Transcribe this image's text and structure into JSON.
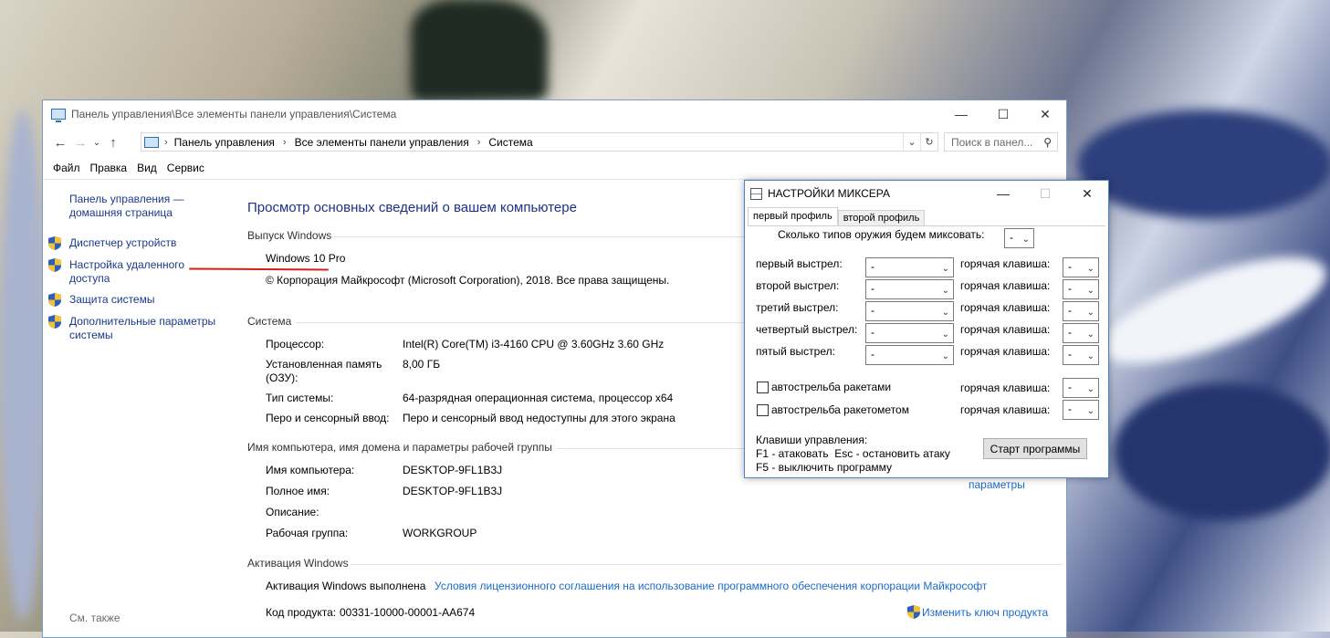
{
  "control_panel": {
    "title": "Панель управления\\Все элементы панели управления\\Система",
    "breadcrumb": [
      "Панель управления",
      "Все элементы панели управления",
      "Система"
    ],
    "search_placeholder": "Поиск в панел...",
    "menu": [
      "Файл",
      "Правка",
      "Вид",
      "Сервис"
    ],
    "sidebar": {
      "home_line1": "Панель управления —",
      "home_line2": "домашняя страница",
      "items": [
        {
          "line1": "Диспетчер устройств",
          "line2": ""
        },
        {
          "line1": "Настройка удаленного",
          "line2": "доступа"
        },
        {
          "line1": "Защита системы",
          "line2": ""
        },
        {
          "line1": "Дополнительные параметры",
          "line2": "системы"
        }
      ],
      "see_also": "См. также"
    },
    "main": {
      "heading": "Просмотр основных сведений о вашем компьютере",
      "edition_section": "Выпуск Windows",
      "edition": "Windows 10 Pro",
      "copyright": "© Корпорация Майкрософт (Microsoft Corporation), 2018. Все права защищены.",
      "system_section": "Система",
      "system_rows": [
        {
          "label": "Процессор:",
          "value": "Intel(R) Core(TM) i3-4160 CPU @ 3.60GHz   3.60 GHz"
        },
        {
          "label": "Установленная память",
          "label2": "(ОЗУ):",
          "value": "8,00 ГБ"
        },
        {
          "label": "Тип системы:",
          "value": "64-разрядная операционная система, процессор x64"
        },
        {
          "label": "Перо и сенсорный ввод:",
          "value": "Перо и сенсорный ввод недоступны для этого экрана"
        }
      ],
      "name_section": "Имя компьютера, имя домена и параметры рабочей группы",
      "name_rows": [
        {
          "label": "Имя компьютера:",
          "value": "DESKTOP-9FL1B3J"
        },
        {
          "label": "Полное имя:",
          "value": "DESKTOP-9FL1B3J"
        },
        {
          "label": "Описание:",
          "value": ""
        },
        {
          "label": "Рабочая группа:",
          "value": "WORKGROUP"
        }
      ],
      "change_params_link": "параметры",
      "activation_section": "Активация Windows",
      "activation_status": "Активация Windows выполнена",
      "license_link": "Условия лицензионного соглашения на использование программного обеспечения корпорации Майкрософт",
      "product_code_label": "Код продукта:",
      "product_code": "00331-10000-00001-AA674",
      "change_key_link": "Изменить ключ продукта"
    }
  },
  "mixer": {
    "title": "НАСТРОЙКИ МИКСЕРА",
    "tabs": [
      "первый профиль",
      "второй профиль"
    ],
    "weapon_types_label": "Сколько типов оружия будем миксовать:",
    "weapon_types_value": "-",
    "shots": [
      {
        "label": "первый выстрел:",
        "value": "-",
        "hotkey_label": "горячая клавиша:",
        "hotkey": "-"
      },
      {
        "label": "второй выстрел:",
        "value": "-",
        "hotkey_label": "горячая клавиша:",
        "hotkey": "-"
      },
      {
        "label": "третий выстрел:",
        "value": "-",
        "hotkey_label": "горячая клавиша:",
        "hotkey": "-"
      },
      {
        "label": "четвертый выстрел:",
        "value": "-",
        "hotkey_label": "горячая клавиша:",
        "hotkey": "-"
      },
      {
        "label": "пятый выстрел:",
        "value": "-",
        "hotkey_label": "горячая клавиша:",
        "hotkey": "-"
      }
    ],
    "auto_rockets": {
      "label": "автострельба ракетами",
      "hotkey_label": "горячая клавиша:",
      "hotkey": "-"
    },
    "auto_launcher": {
      "label": "автострельба ракетометом",
      "hotkey_label": "горячая клавиша:",
      "hotkey": "-"
    },
    "controls_title": "Клавиши управления:",
    "controls_line1": "F1 - атаковать  Esc - остановить атаку",
    "controls_line2": "F5 - выключить программу",
    "start_button": "Старт программы"
  }
}
